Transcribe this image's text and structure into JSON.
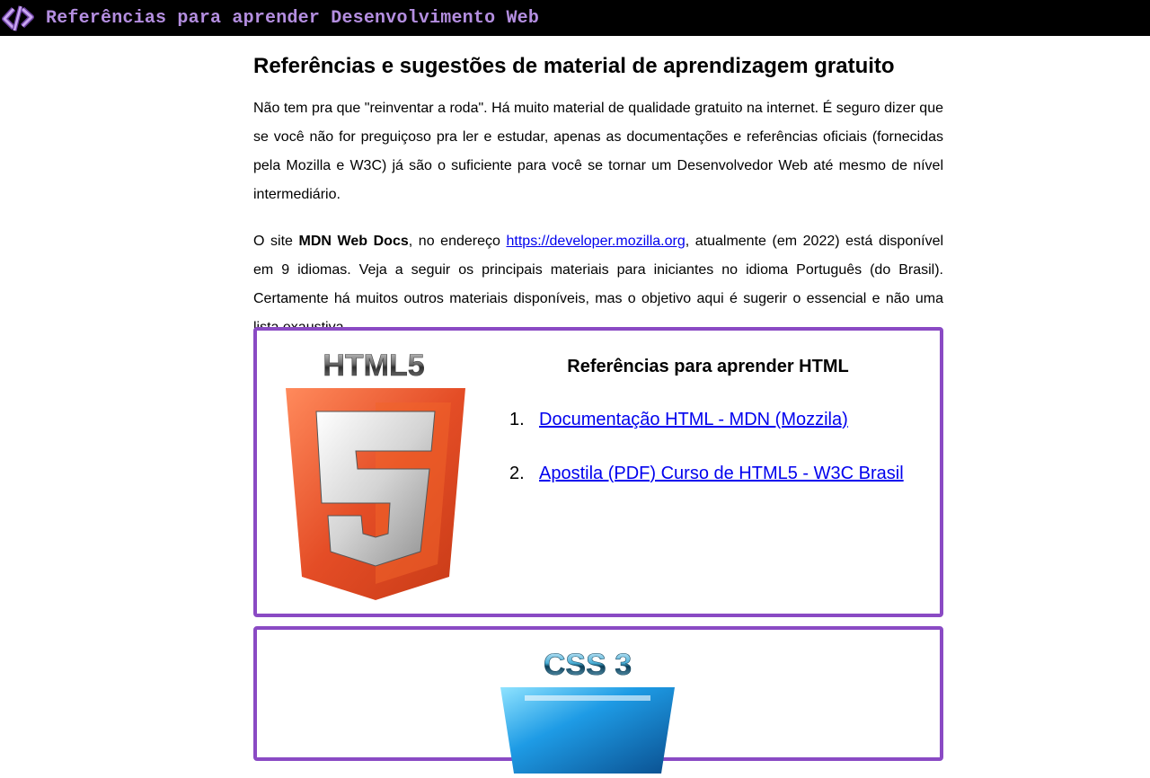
{
  "header": {
    "logo_icon": "code-brackets-icon",
    "title": "Referências para aprender Desenvolvimento Web"
  },
  "main": {
    "heading": "Referências e sugestões de material de aprendizagem gratuito",
    "intro": "Não tem pra que \"reinventar a roda\". Há muito material de qualidade gratuito na internet. É seguro dizer que se você não for preguiçoso pra ler e estudar, apenas as documentações e referências oficiais (fornecidas pela Mozilla e W3C) já são o suficiente para você se tornar um Desenvolvedor Web até mesmo de nível intermediário.",
    "p2_start": "O site ",
    "p2_bold": "MDN Web Docs",
    "p2_mid": ", no endereço ",
    "p2_link": "https://developer.mozilla.org",
    "p2_end": ", atualmente (em 2022) está disponível em 9 idiomas. Veja a seguir os principais materiais para iniciantes no idioma Português (do Brasil). Certamente há muitos outros materiais disponíveis, mas o objetivo aqui é sugerir o essencial e não uma lista exaustiva."
  },
  "html_card": {
    "logo_text": "HTML5",
    "logo_number": "5",
    "title": "Referências para aprender HTML",
    "links": [
      {
        "num": "1.",
        "label": "Documentação HTML - MDN (Mozzila)"
      },
      {
        "num": "2.",
        "label": "Apostila (PDF) Curso de HTML5 - W3C Brasil"
      }
    ]
  },
  "css_card": {
    "logo_text": "CSS 3"
  },
  "colors": {
    "accent": "#8a4ac4",
    "header_bg": "#000000",
    "header_text": "#b48ee0",
    "html_orange": "#e44d26",
    "css_blue": "#1e88e5"
  }
}
